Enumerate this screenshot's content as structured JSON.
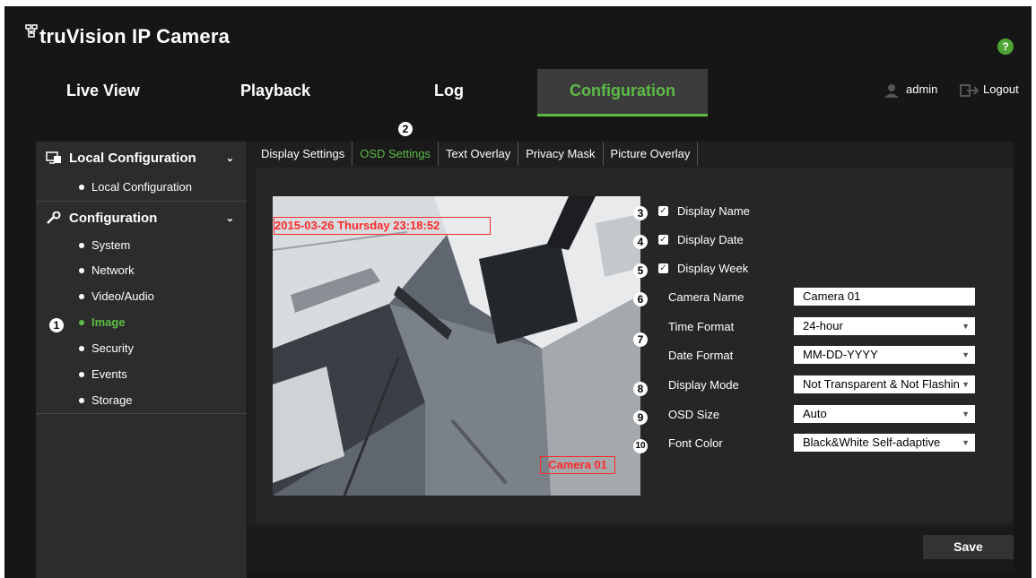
{
  "app": {
    "title": "truVision IP Camera",
    "help_label": "?"
  },
  "nav": {
    "tabs": [
      "Live View",
      "Playback",
      "Log",
      "Configuration"
    ]
  },
  "user": {
    "name": "admin",
    "logout": "Logout"
  },
  "sidebar": {
    "groups": [
      {
        "label": "Local Configuration",
        "items": [
          "Local Configuration"
        ]
      },
      {
        "label": "Configuration",
        "items": [
          "System",
          "Network",
          "Video/Audio",
          "Image",
          "Security",
          "Events",
          "Storage"
        ]
      }
    ],
    "active_item": "Image"
  },
  "subtabs": [
    "Display Settings",
    "OSD Settings",
    "Text Overlay",
    "Privacy Mask",
    "Picture Overlay"
  ],
  "preview": {
    "osd_date": "2015-03-26 Thursday 23:18:52",
    "osd_name": "Camera 01"
  },
  "osd": {
    "display_name": {
      "label": "Display Name",
      "checked": true
    },
    "display_date": {
      "label": "Display Date",
      "checked": true
    },
    "display_week": {
      "label": "Display Week",
      "checked": true
    },
    "camera_name": {
      "label": "Camera Name",
      "value": "Camera 01"
    },
    "time_format": {
      "label": "Time Format",
      "value": "24-hour"
    },
    "date_format": {
      "label": "Date Format",
      "value": "MM-DD-YYYY"
    },
    "display_mode": {
      "label": "Display Mode",
      "value": "Not Transparent & Not Flashing"
    },
    "osd_size": {
      "label": "OSD Size",
      "value": "Auto"
    },
    "font_color": {
      "label": "Font Color",
      "value": "Black&White Self-adaptive"
    }
  },
  "callouts": [
    "1",
    "2",
    "3",
    "4",
    "5",
    "6",
    "7",
    "8",
    "9",
    "10"
  ],
  "actions": {
    "save": "Save"
  },
  "colors": {
    "accent": "#5dbb46",
    "osd_text": "#ff2a2a",
    "background": "#161616"
  },
  "icons": {
    "logo": "network-icon",
    "help": "help-icon",
    "user": "user-icon",
    "logout": "logout-icon",
    "local_config": "monitor-icon",
    "config": "wrench-icon",
    "dropdown": "chevron-down-icon"
  }
}
